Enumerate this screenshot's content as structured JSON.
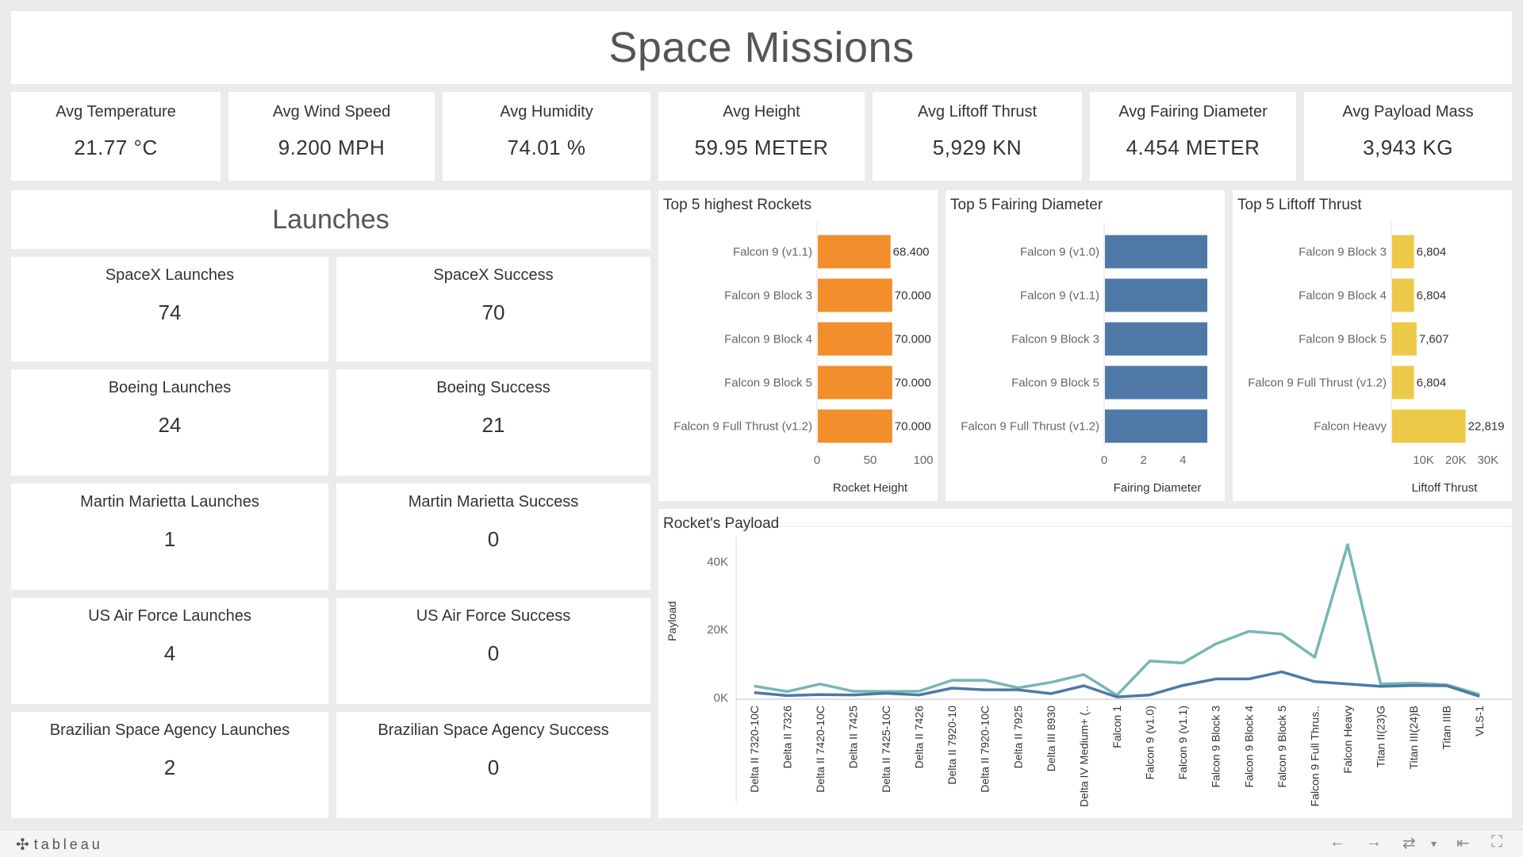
{
  "title": "Space Missions",
  "kpis": [
    {
      "label": "Avg Temperature",
      "value": "21.77 °C"
    },
    {
      "label": "Avg Wind Speed",
      "value": "9.200 MPH"
    },
    {
      "label": "Avg Humidity",
      "value": "74.01 %"
    },
    {
      "label": "Avg Height",
      "value": "59.95 METER"
    },
    {
      "label": "Avg Liftoff Thrust",
      "value": "5,929 KN"
    },
    {
      "label": "Avg Fairing Diameter",
      "value": "4.454 METER"
    },
    {
      "label": "Avg Payload Mass",
      "value": "3,943 KG"
    }
  ],
  "launches": {
    "heading": "Launches",
    "cards": [
      {
        "label": "SpaceX Launches",
        "value": "74"
      },
      {
        "label": "SpaceX Success",
        "value": "70"
      },
      {
        "label": "Boeing Launches",
        "value": "24"
      },
      {
        "label": "Boeing Success",
        "value": "21"
      },
      {
        "label": "Martin Marietta Launches",
        "value": "1"
      },
      {
        "label": "Martin Marietta Success",
        "value": "0"
      },
      {
        "label": "US Air Force Launches",
        "value": "4"
      },
      {
        "label": "US Air Force Success",
        "value": "0"
      },
      {
        "label": "Brazilian Space Agency Launches",
        "value": "2"
      },
      {
        "label": "Brazilian Space Agency Success",
        "value": "0"
      }
    ]
  },
  "chart_data": [
    {
      "type": "bar",
      "title": "Top 5 highest Rockets",
      "xlabel": "Rocket Height",
      "categories": [
        "Falcon 9 (v1.1)",
        "Falcon 9 Block 3",
        "Falcon 9 Block 4",
        "Falcon 9 Block 5",
        "Falcon 9 Full Thrust (v1.2)"
      ],
      "values": [
        68.4,
        70,
        70,
        70,
        70
      ],
      "value_labels": [
        "68.400",
        "70.000",
        "70.000",
        "70.000",
        "70.000"
      ],
      "xlim": [
        0,
        100
      ],
      "ticks": [
        "0",
        "50",
        "100"
      ],
      "tick_values": [
        0,
        50,
        100
      ],
      "color": "#f28e2b"
    },
    {
      "type": "bar",
      "title": "Top 5 Fairing Diameter",
      "xlabel": "Fairing Diameter",
      "categories": [
        "Falcon 9 (v1.0)",
        "Falcon 9 (v1.1)",
        "Falcon 9 Block 3",
        "Falcon 9 Block 5",
        "Falcon 9 Full Thrust (v1.2)"
      ],
      "values": [
        5.2,
        5.2,
        5.2,
        5.2,
        5.2
      ],
      "value_labels": [
        "",
        "",
        "",
        "",
        ""
      ],
      "xlim": [
        0,
        5.4
      ],
      "ticks": [
        "0",
        "2",
        "4"
      ],
      "tick_values": [
        0,
        2,
        4
      ],
      "color": "#4e79a7"
    },
    {
      "type": "bar",
      "title": "Top 5 Liftoff Thrust",
      "xlabel": "Liftoff Thrust",
      "categories": [
        "Falcon 9 Block 3",
        "Falcon 9 Block 4",
        "Falcon 9 Block 5",
        "Falcon 9 Full Thrust (v1.2)",
        "Falcon Heavy"
      ],
      "values": [
        6804,
        6804,
        7607,
        6804,
        22819
      ],
      "value_labels": [
        "6,804",
        "6,804",
        "7,607",
        "6,804",
        "22,819"
      ],
      "xlim": [
        0,
        33000
      ],
      "ticks": [
        "10K",
        "20K",
        "30K"
      ],
      "tick_values": [
        10000,
        20000,
        30000
      ],
      "color": "#edc948"
    },
    {
      "type": "line",
      "title": "Rocket's Payload",
      "ylabel": "Payload",
      "ylim": [
        0,
        45000
      ],
      "yticks": [
        "0K",
        "20K",
        "40K"
      ],
      "ytick_values": [
        0,
        20000,
        40000
      ],
      "categories": [
        "Delta II 7320-10C",
        "Delta II 7326",
        "Delta II 7420-10C",
        "Delta II 7425",
        "Delta II 7425-10C",
        "Delta II 7426",
        "Delta II 7920-10",
        "Delta II 7920-10C",
        "Delta II 7925",
        "Delta III 8930",
        "Delta IV Medium+ (..",
        "Falcon 1",
        "Falcon 9 (v1.0)",
        "Falcon 9 (v1.1)",
        "Falcon 9 Block 3",
        "Falcon 9 Block 4",
        "Falcon 9 Block 5",
        "Falcon 9 Full Thrus..",
        "Falcon Heavy",
        "Titan II(23)G",
        "Titan III(24)B",
        "Titan IIIB",
        "VLS-1"
      ],
      "series": [
        {
          "color": "#76b7b2",
          "values": [
            3400,
            1800,
            4000,
            1900,
            1800,
            1900,
            5100,
            5100,
            2900,
            4500,
            6800,
            700,
            10800,
            10200,
            15800,
            19500,
            18700,
            11900,
            45000,
            4000,
            4300,
            3800,
            900
          ]
        },
        {
          "color": "#4e79a7",
          "values": [
            1500,
            600,
            900,
            800,
            1300,
            800,
            2800,
            2300,
            2300,
            1200,
            3500,
            200,
            800,
            3600,
            5500,
            5500,
            7600,
            4700,
            4000,
            3300,
            3600,
            3500,
            400
          ]
        }
      ]
    }
  ],
  "footer": {
    "brand": "tableau",
    "brand_icon": "tableau-logo-icon",
    "buttons": {
      "undo": "←",
      "redo": "→",
      "revert": "⇄",
      "menu": "▾",
      "back": "⇤",
      "fullscreen": "⛶"
    }
  }
}
